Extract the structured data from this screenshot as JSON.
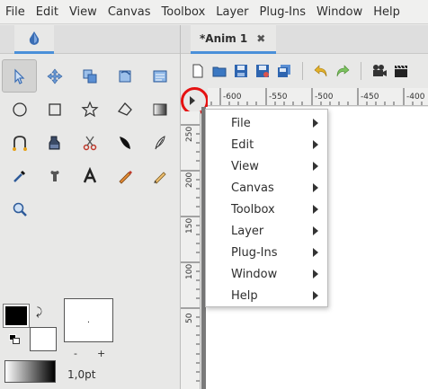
{
  "menubar": {
    "items": [
      "File",
      "Edit",
      "View",
      "Canvas",
      "Toolbox",
      "Layer",
      "Plug-Ins",
      "Window",
      "Help"
    ]
  },
  "toolbox": {
    "tab_icon": "synfig-logo-icon",
    "tools": [
      "transform-tool-icon",
      "smooth-move-tool-icon",
      "scale-tool-icon",
      "rotate-tool-icon",
      "mirror-tool-icon",
      "circle-tool-icon",
      "rectangle-tool-icon",
      "star-tool-icon",
      "polygon-tool-icon",
      "gradient-tool-icon",
      "spline-tool-icon",
      "fill-tool-icon",
      "cutout-tool-icon",
      "width-tool-icon",
      "feather-tool-icon",
      "eyedropper-tool-icon",
      "bone-tool-icon",
      "text-tool-icon",
      "draw-tool-icon",
      "sketch-tool-icon",
      "zoom-tool-icon"
    ],
    "brush_size_value": ".",
    "minus_label": "-",
    "plus_label": "+",
    "width_value": "1,0pt",
    "outline_color": "#000000",
    "fill_color": "#ffffff"
  },
  "document": {
    "tab_title": "*Anim 1",
    "close_label": "✖",
    "ruler_h_labels": [
      "-600",
      "-550",
      "-500",
      "-450",
      "-400"
    ],
    "ruler_v_labels": [
      "250",
      "200",
      "150",
      "100",
      "50"
    ]
  },
  "popup_menu": {
    "items": [
      {
        "label": "File"
      },
      {
        "label": "Edit"
      },
      {
        "label": "View"
      },
      {
        "label": "Canvas"
      },
      {
        "label": "Toolbox"
      },
      {
        "label": "Layer"
      },
      {
        "label": "Plug-Ins"
      },
      {
        "label": "Window"
      },
      {
        "label": "Help"
      }
    ]
  },
  "colors": {
    "accent": "#4a90d9",
    "highlight_ring": "#e51212"
  }
}
